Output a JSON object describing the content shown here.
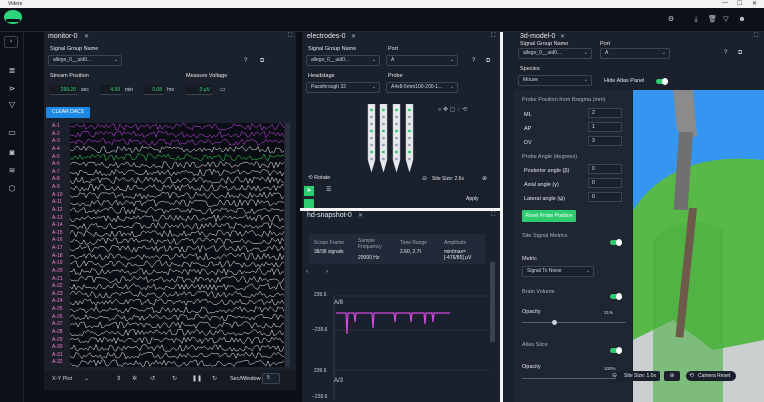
{
  "window": {
    "title": "Videre",
    "controls": [
      "—",
      "☐",
      "✕"
    ]
  },
  "topbar_icons": [
    "gear-icon",
    "download-icon",
    "trash-icon",
    "filter-icon",
    "user-icon"
  ],
  "monitor": {
    "tab": "monitor-0",
    "signal_group_label": "Signal Group Name",
    "signal_group_value": "allego_0__uid0...",
    "stream_position_label": "Stream Position",
    "measure_voltage_label": "Measure Voltage",
    "sec_value": "299.20",
    "sec_unit": "sec",
    "min_value": "4.99",
    "min_unit": "min",
    "hrs_value": "0.08",
    "hrs_unit": "hrs",
    "voltage_value": "0 μV",
    "clear_button": "CLEAR DACS",
    "channels": [
      "A-1",
      "A-2",
      "A-3",
      "A-4",
      "A-5",
      "A-6",
      "A-7",
      "A-8",
      "A-9",
      "A-10",
      "A-11",
      "A-12",
      "A-13",
      "A-14",
      "A-15",
      "A-16",
      "A-17",
      "A-18",
      "A-19",
      "A-20",
      "A-21",
      "A-22",
      "A-23",
      "A-24",
      "A-25",
      "A-26",
      "A-27",
      "A-28",
      "A-29",
      "A-30",
      "A-31",
      "A-32"
    ],
    "trace_colors": [
      "#d94dff",
      "#d94dff",
      "#d94dff",
      "#ffffff",
      "#3ee65a",
      "#ffffff"
    ],
    "bottom": {
      "plot_type": "X-Y Plot",
      "sec_window": "Sec/Window",
      "window_value": "5"
    }
  },
  "electrodes": {
    "tab": "electrodes-0",
    "signal_group_label": "Signal Group Name",
    "signal_group_value": "allego_0__uid0...",
    "port_label": "Port",
    "port_value": "A",
    "headstage_label": "Headstage",
    "headstage_value": "Passthrough 32",
    "probe_label": "Probe",
    "probe_value": "A4x8-5mm100-200-1...",
    "rotate": "Rotate",
    "site_size": "Site Size: 2.6x",
    "apply": "Apply"
  },
  "snapshot": {
    "tab": "hd-snapshot-0",
    "scope_frame_label": "Scope Frame",
    "scope_frame_value": "38/38 signals",
    "sample_freq_label": "Sample Frequency",
    "sample_freq_value": "20000 Hz",
    "time_range_label": "Time Range",
    "time_range_value": "2.60, 2.7t",
    "amplitude_label": "Amplitude",
    "amplitude_value": "min/max= [-476/85] μV",
    "y_top": "239.6",
    "y_mid": "−239.6",
    "y_low": "239.6",
    "y_low2": "−239.6",
    "ch_a8": "A/8",
    "ch_a3": "A/3"
  },
  "model3d": {
    "tab": "3d-model-0",
    "signal_group_label": "Signal Group Name",
    "signal_group_value": "allego_0__uid0...",
    "port_label": "Port",
    "port_value": "A",
    "species_label": "Species",
    "species_value": "Mouse",
    "hide_atlas": "Hide Atlas Panel",
    "probe_pos_title": "Probe Position from Bregma (mm)",
    "ml_label": "ML",
    "ml_value": "2",
    "ap_label": "AP",
    "ap_value": "1",
    "dv_label": "DV",
    "dv_value": "3",
    "probe_angle_title": "Probe Angle (degrees)",
    "posterior_label": "Posterior angle (β)",
    "posterior_value": "0",
    "axial_label": "Axial angle (γ)",
    "axial_value": "0",
    "lateral_label": "Lateral angle (ψ)",
    "lateral_value": "0",
    "reset_button": "Reset Probe Position",
    "site_metrics": "Site Signal Metrics",
    "metric_label": "Metric",
    "metric_value": "Signal To Noise",
    "brain_volume": "Brain Volume",
    "opacity_label": "Opacity",
    "opacity_value": "31%",
    "atlas_slice": "Atlas Slice",
    "opacity2_label": "Opacity",
    "opacity2_value": "100%",
    "site_size": "Site Size: 1.0x",
    "camera_reset": "Camera Reset"
  }
}
